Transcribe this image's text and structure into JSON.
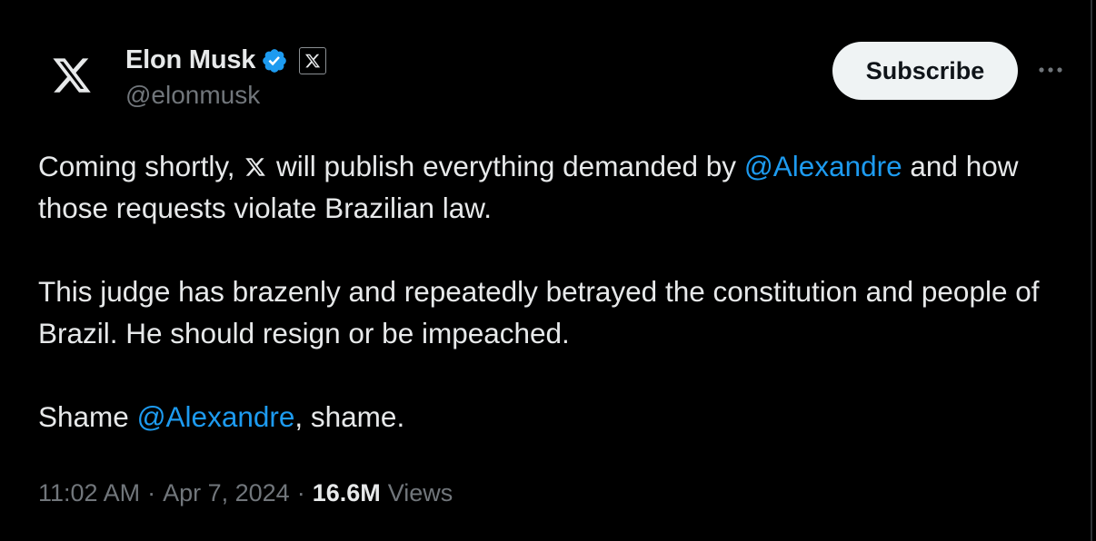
{
  "author": {
    "display_name": "Elon Musk",
    "handle": "@elonmusk",
    "avatar_icon": "x-logo-icon",
    "verified_icon": "verified-badge-icon",
    "verified_color": "#1d9bf0",
    "affiliate_icon": "x-affiliate-badge-icon"
  },
  "actions": {
    "subscribe_label": "Subscribe",
    "more_icon": "more-horizontal-icon"
  },
  "tweet": {
    "p1_text_a": "Coming shortly, ",
    "p1_inline_icon": "x-logo-icon",
    "p1_text_b": " will publish everything demanded by ",
    "p1_mention": "@Alexandre",
    "p1_text_c": " and how those requests violate Brazilian law.",
    "p2_text": "This judge has brazenly and repeatedly betrayed the constitution and people of Brazil. He should resign or be impeached.",
    "p3_text_a": "Shame ",
    "p3_mention": "@Alexandre",
    "p3_text_b": ", shame."
  },
  "meta": {
    "time": "11:02 AM",
    "separator": "·",
    "date": "Apr 7, 2024",
    "views_count": "16.6M",
    "views_label": "Views"
  },
  "colors": {
    "background": "#000000",
    "text_primary": "#e7e9ea",
    "text_secondary": "#71767b",
    "mention": "#1d9bf0",
    "button_bg": "#eff3f4"
  }
}
